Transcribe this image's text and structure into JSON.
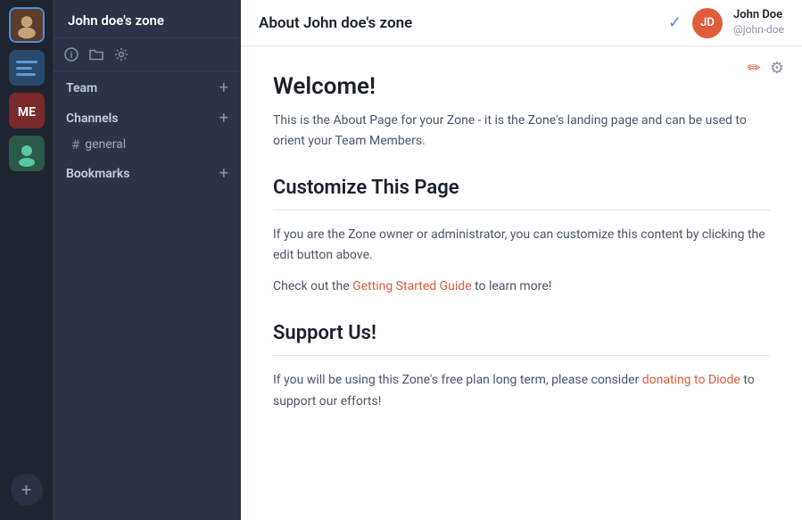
{
  "iconBar": {
    "addLabel": "+"
  },
  "sidebar": {
    "zoneName": "John doe's zone",
    "team": {
      "label": "Team",
      "addIcon": "+"
    },
    "channels": {
      "label": "Channels",
      "addIcon": "+",
      "items": [
        {
          "name": "general",
          "hash": "#"
        }
      ]
    },
    "bookmarks": {
      "label": "Bookmarks",
      "addIcon": "+"
    }
  },
  "header": {
    "title": "About John doe's zone",
    "checkIcon": "✓",
    "user": {
      "initials": "JD",
      "name": "John Doe",
      "handle": "@john-doe"
    }
  },
  "content": {
    "editIcon": "✎",
    "settingsIcon": "⚙",
    "welcome": {
      "title": "Welcome!",
      "text": "This is the About Page for your Zone - it is the Zone's landing page and can be used to orient your Team Members."
    },
    "customize": {
      "title": "Customize This Page",
      "text": "If you are the Zone owner or administrator, you can customize this content by clicking the edit button above.",
      "linkLabel": "Getting Started Guide",
      "afterLink": " to learn more!",
      "checkPrefix": "Check out the "
    },
    "support": {
      "title": "Support Us!",
      "textBefore": "If you will be using this Zone's free plan long term, please consider ",
      "linkLabel": "donating to Diode",
      "textAfter": " to support our efforts!"
    }
  }
}
